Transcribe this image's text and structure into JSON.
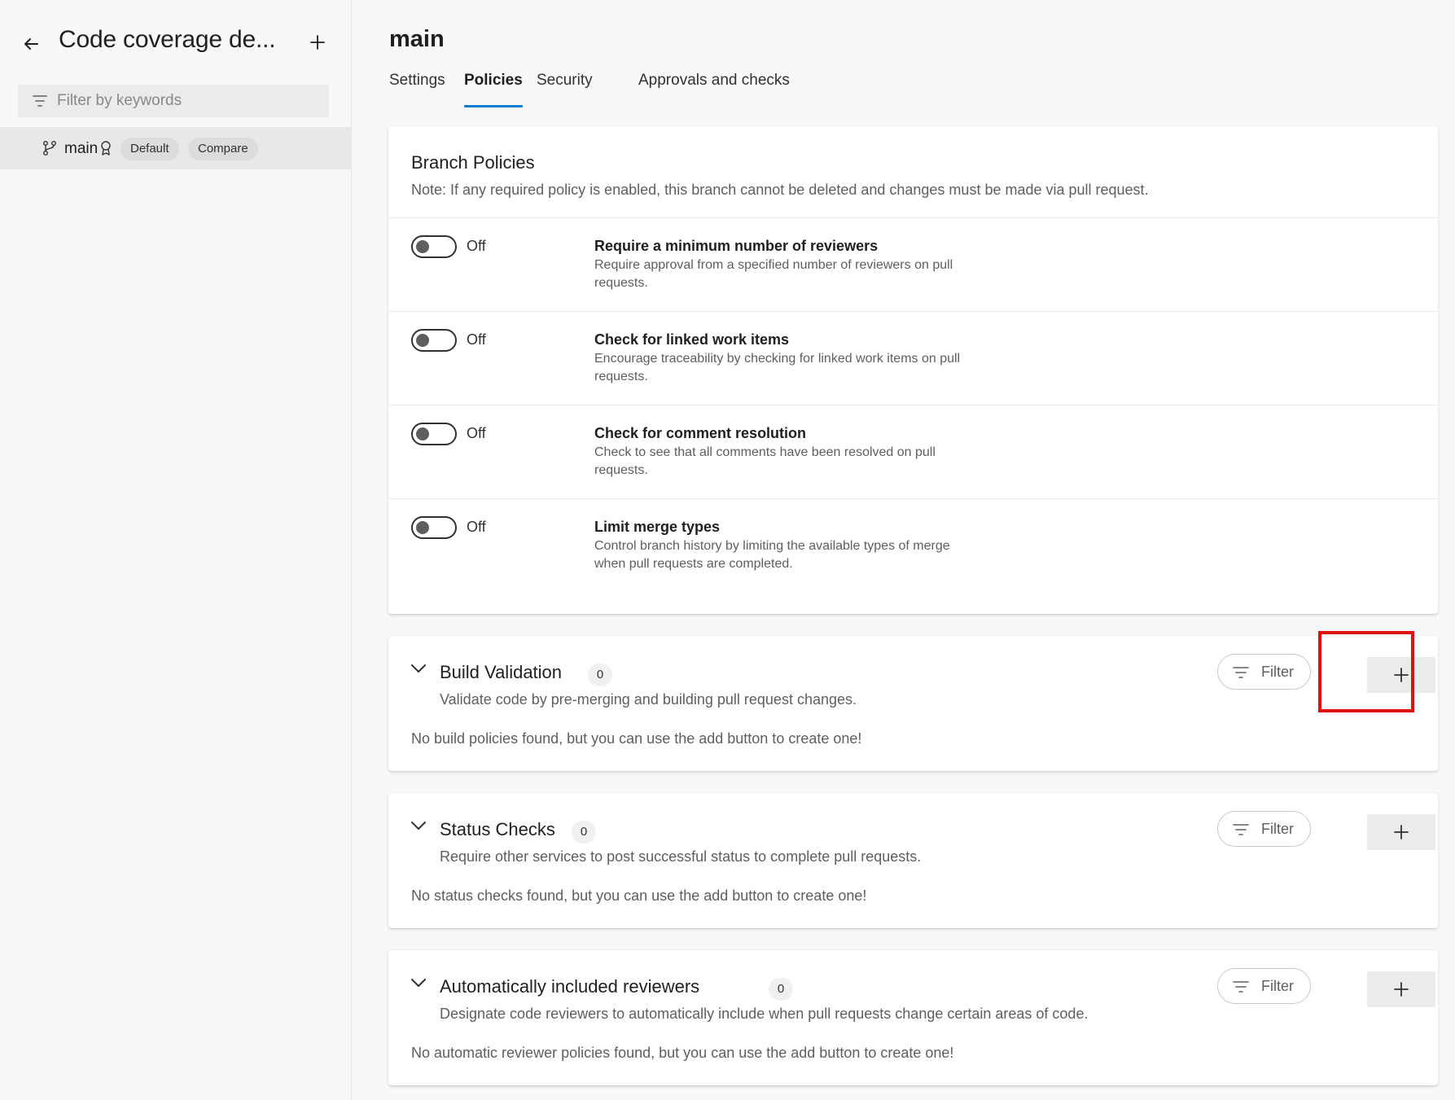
{
  "sidebar": {
    "title": "Code coverage de...",
    "filter_placeholder": "Filter by keywords",
    "branch": {
      "name": "main",
      "badges": [
        "Default",
        "Compare"
      ]
    }
  },
  "main": {
    "title": "main",
    "tabs": [
      {
        "label": "Settings",
        "active": false
      },
      {
        "label": "Policies",
        "active": true
      },
      {
        "label": "Security",
        "active": false
      },
      {
        "label": "Approvals and checks",
        "active": false
      }
    ],
    "branch_policies": {
      "title": "Branch Policies",
      "note": "Note: If any required policy is enabled, this branch cannot be deleted and changes must be made via pull request.",
      "policies": [
        {
          "state": "Off",
          "title": "Require a minimum number of reviewers",
          "desc": "Require approval from a specified number of reviewers on pull requests."
        },
        {
          "state": "Off",
          "title": "Check for linked work items",
          "desc": "Encourage traceability by checking for linked work items on pull requests."
        },
        {
          "state": "Off",
          "title": "Check for comment resolution",
          "desc": "Check to see that all comments have been resolved on pull requests."
        },
        {
          "state": "Off",
          "title": "Limit merge types",
          "desc": "Control branch history by limiting the available types of merge when pull requests are completed."
        }
      ]
    },
    "sections": [
      {
        "title": "Build Validation",
        "count": "0",
        "desc": "Validate code by pre-merging and building pull request changes.",
        "empty": "No build policies found, but you can use the add button to create one!",
        "filter_label": "Filter"
      },
      {
        "title": "Status Checks",
        "count": "0",
        "desc": "Require other services to post successful status to complete pull requests.",
        "empty": "No status checks found, but you can use the add button to create one!",
        "filter_label": "Filter"
      },
      {
        "title": "Automatically included reviewers",
        "count": "0",
        "desc": "Designate code reviewers to automatically include when pull requests change certain areas of code.",
        "empty": "No automatic reviewer policies found, but you can use the add button to create one!",
        "filter_label": "Filter"
      }
    ]
  },
  "icons": {
    "back": "arrow-left-icon",
    "add": "plus-icon",
    "filter": "filter-icon",
    "branch": "git-branch-icon",
    "lock": "lock-icon",
    "chevron": "chevron-down-icon"
  },
  "colors": {
    "accent": "#0078d4",
    "highlight": "#e01010"
  }
}
